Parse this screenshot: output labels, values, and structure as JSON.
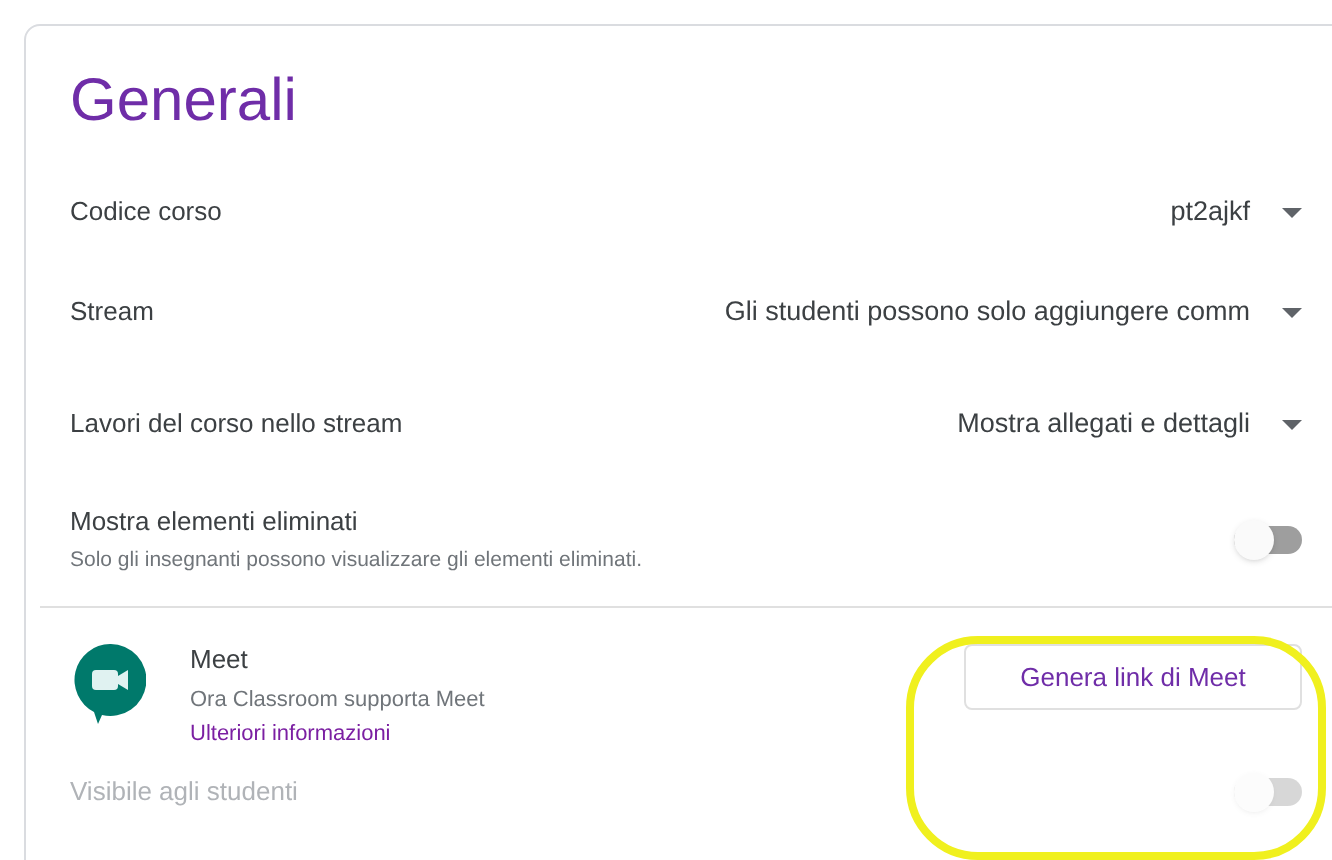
{
  "title": "Generali",
  "dropdowns": [
    {
      "label": "Codice corso",
      "value": "pt2ajkf"
    },
    {
      "label": "Stream",
      "value": "Gli studenti possono solo aggiungere comm"
    },
    {
      "label": "Lavori del corso nello stream",
      "value": "Mostra allegati e dettagli"
    }
  ],
  "deleted_items": {
    "label": "Mostra elementi eliminati",
    "description": "Solo gli insegnanti possono visualizzare gli elementi eliminati.",
    "on": false
  },
  "meet": {
    "title": "Meet",
    "description": "Ora Classroom supporta Meet",
    "link": "Ulteriori informazioni",
    "button": "Genera link di Meet",
    "visibility": {
      "label": "Visibile agli studenti",
      "on": false,
      "disabled": true
    }
  }
}
